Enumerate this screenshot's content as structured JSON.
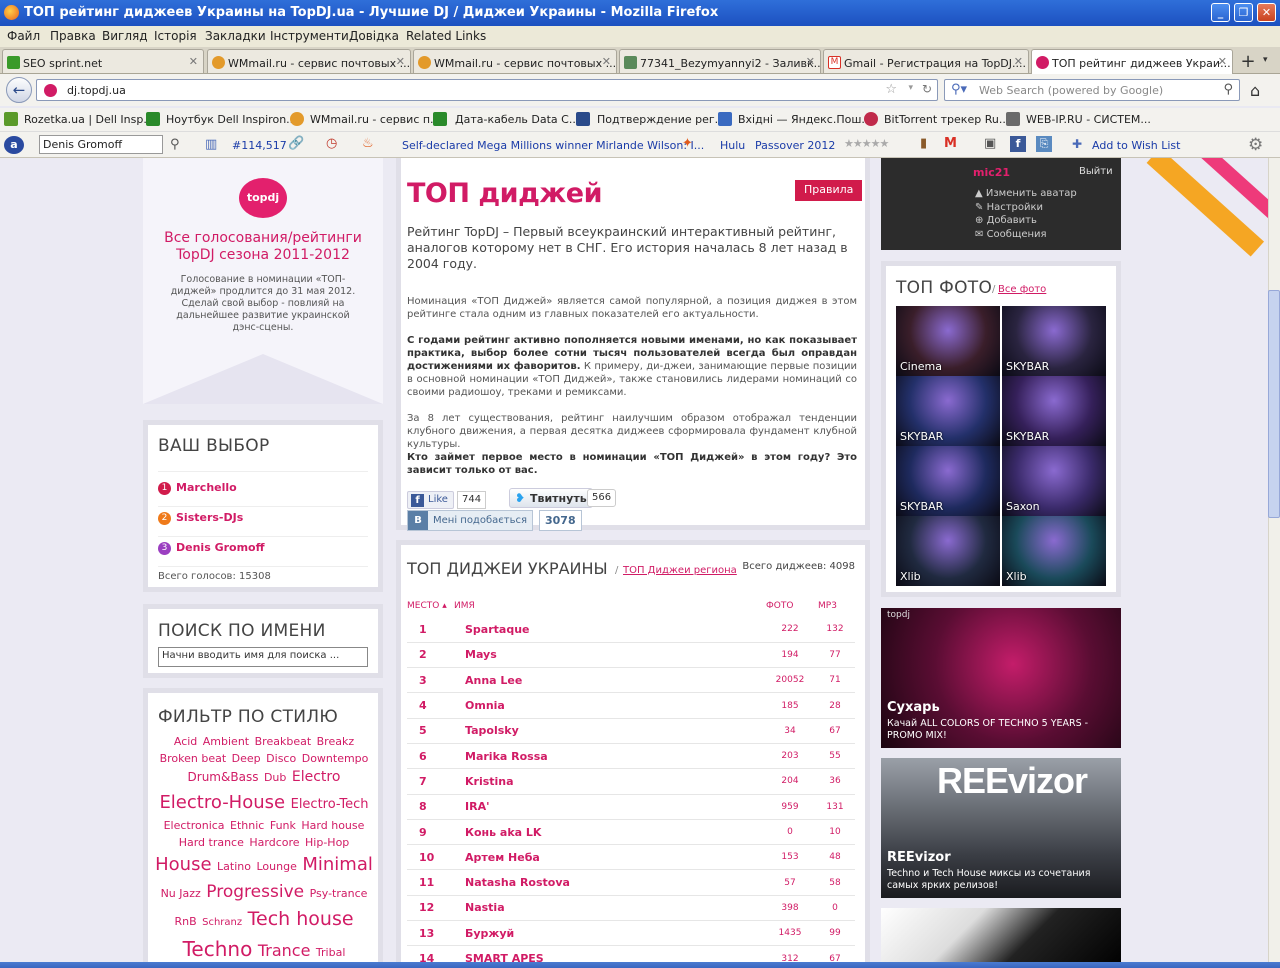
{
  "window": {
    "title": "ТОП рейтинг диджеев Украины на TopDJ.ua - Лучшие DJ / Диджеи Украины - Mozilla Firefox"
  },
  "menu": [
    "Файл",
    "Правка",
    "Вигляд",
    "Історія",
    "Закладки",
    "Інструменти",
    "Довідка",
    "Related Links"
  ],
  "tabs": [
    {
      "label": "SEO sprint.net",
      "color": "#3a9a2a"
    },
    {
      "label": "WMmail.ru - сервис почтовых ...",
      "color": "#e39a2a"
    },
    {
      "label": "WMmail.ru - сервис почтовых ...",
      "color": "#e39a2a"
    },
    {
      "label": "77341_Bezymyannyi2 - Заливк...",
      "color": "#5a8a5a"
    },
    {
      "label": "Gmail - Регистрация на TopDJ....",
      "color": "#d93025"
    },
    {
      "label": "ТОП рейтинг диджеев Украи...",
      "color": "#d11b65"
    }
  ],
  "nav": {
    "url": "dj.topdj.ua",
    "search_placeholder": "Web Search (powered by Google)"
  },
  "bookmarks": [
    "Rozetka.ua | Dell Insp...",
    "Ноутбук Dell Inspiron...",
    "WMmail.ru - сервис п...",
    "Дата-кабель Data C...",
    "Подтверждение рег...",
    "Вхідні — Яндекс.Пош...",
    "BitTorrent трекер Ru...",
    "WEB-IP.RU - СИСТЕМ..."
  ],
  "toolbar2": {
    "user": "Denis Gromoff",
    "rank": "#114,517",
    "news": "Self-declared Mega Millions winner Mirlande Wilson: I...",
    "hulu": "Hulu",
    "passover": "Passover 2012",
    "wishlist": "Add to Wish List"
  },
  "promo": {
    "logo": "topdj",
    "title": "Все голосования/рейтинги TopDJ сезона 2011-2012",
    "text": "Голосование в номинации «ТОП-диджей» продлится до 31 мая 2012. Сделай свой выбор - повлияй на дальнейшее развитие украинской дэнс-сцены."
  },
  "choice": {
    "title": "ВАШ ВЫБОР",
    "items": [
      {
        "num": "1",
        "name": "Marchello",
        "color": "#d11b4b"
      },
      {
        "num": "2",
        "name": "Sisters-DJs",
        "color": "#ef7a1a"
      },
      {
        "num": "3",
        "name": "Denis Gromoff",
        "color": "#9b3fc1"
      }
    ],
    "total": "Всего голосов: 15308"
  },
  "search_by_name": {
    "title": "ПОИСК ПО ИМЕНИ",
    "placeholder": "Начни вводить имя для поиска ..."
  },
  "style_filter": {
    "title": "ФИЛЬТР ПО СТИЛЮ",
    "tags": [
      {
        "t": "Acid",
        "s": 11
      },
      {
        "t": "Ambient",
        "s": 11
      },
      {
        "t": "Breakbeat",
        "s": 11
      },
      {
        "t": "Breakz",
        "s": 11
      },
      {
        "t": "Broken beat",
        "s": 11
      },
      {
        "t": "Deep",
        "s": 11
      },
      {
        "t": "Disco",
        "s": 11
      },
      {
        "t": "Downtempo",
        "s": 11
      },
      {
        "t": "Drum&Bass",
        "s": 12
      },
      {
        "t": "Dub",
        "s": 11
      },
      {
        "t": "Electro",
        "s": 14
      },
      {
        "t": "Electro-House",
        "s": 18
      },
      {
        "t": "Electro-Tech",
        "s": 13
      },
      {
        "t": "Electronica",
        "s": 11
      },
      {
        "t": "Ethnic",
        "s": 11
      },
      {
        "t": "Funk",
        "s": 11
      },
      {
        "t": "Hard house",
        "s": 11
      },
      {
        "t": "Hard trance",
        "s": 11
      },
      {
        "t": "Hardcore",
        "s": 11
      },
      {
        "t": "Hip-Hop",
        "s": 11
      },
      {
        "t": "House",
        "s": 18
      },
      {
        "t": "Latino",
        "s": 11
      },
      {
        "t": "Lounge",
        "s": 11
      },
      {
        "t": "Minimal",
        "s": 18
      },
      {
        "t": "Nu Jazz",
        "s": 11
      },
      {
        "t": "Progressive",
        "s": 17
      },
      {
        "t": "Psy-trance",
        "s": 11
      },
      {
        "t": "RnB",
        "s": 11
      },
      {
        "t": "Schranz",
        "s": 10
      },
      {
        "t": "Tech house",
        "s": 19
      },
      {
        "t": "Techno",
        "s": 20
      },
      {
        "t": "Trance",
        "s": 16
      },
      {
        "t": "Tribal",
        "s": 11
      }
    ]
  },
  "top_dj": {
    "title": "ТОП диджей",
    "rules": "Правила",
    "lead": "Рейтинг TopDJ – Первый всеукраинский интерактивный рейтинг, аналогов которому нет в СНГ. Его история началась 8 лет назад в 2004 году.",
    "p1": "Номинация «ТОП Диджей» является самой популярной, а позиция диджея в этом рейтинге стала одним из главных показателей его актуальности.",
    "p2_bold": "С годами рейтинг активно пополняется новыми именами, но как показывает практика, выбор более сотни тысяч пользователей всегда был оправдан достижениями их фаворитов.",
    "p2_rest": " К примеру, ди-джеи, занимающие первые позиции в основной номинации «ТОП Диджей», также становились лидерами номинаций со своими радиошоу, треками и ремиксами.",
    "p3": "За 8 лет существования, рейтинг наилучшим образом отображал тенденции клубного движения, а первая десятка диджеев сформировала фундамент клубной культуры.",
    "p4": "Кто займет первое место в номинации «ТОП Диджей» в этом году? Это зависит только от вас.",
    "fb_like": "Like",
    "fb_count": "744",
    "tw_label": "Твитнуть",
    "tw_count": "566",
    "vk_label": "Мені подобається",
    "vk_count": "3078"
  },
  "ranking": {
    "title": "ТОП ДИДЖЕИ УКРАИНЫ",
    "region_link": "ТОП Диджеи региона",
    "total": "Всего диджеев: 4098",
    "headers": {
      "place": "МЕСТО",
      "name": "ИМЯ",
      "photo": "ФОТО",
      "mp3": "MP3"
    },
    "rows": [
      [
        "1",
        "Spartaque",
        "222",
        "132"
      ],
      [
        "2",
        "Mays",
        "194",
        "77"
      ],
      [
        "3",
        "Anna Lee",
        "20052",
        "71"
      ],
      [
        "4",
        "Omnia",
        "185",
        "28"
      ],
      [
        "5",
        "Tapolsky",
        "34",
        "67"
      ],
      [
        "6",
        "Marika Rossa",
        "203",
        "55"
      ],
      [
        "7",
        "Kristina",
        "204",
        "36"
      ],
      [
        "8",
        "IRA'",
        "959",
        "131"
      ],
      [
        "9",
        "Конь aka LK",
        "0",
        "10"
      ],
      [
        "10",
        "Артем Неба",
        "153",
        "48"
      ],
      [
        "11",
        "Natasha Rostova",
        "57",
        "58"
      ],
      [
        "12",
        "Nastia",
        "398",
        "0"
      ],
      [
        "13",
        "Буржуй",
        "1435",
        "99"
      ],
      [
        "14",
        "SMART APES",
        "312",
        "67"
      ]
    ]
  },
  "user_box": {
    "username": "mic21",
    "logout": "Выйти",
    "links": [
      "Изменить аватар",
      "Настройки",
      "Добавить",
      "Сообщения"
    ]
  },
  "top_photo": {
    "title": "ТОП ФОТО",
    "all_link": "Все фото",
    "photos": [
      {
        "cap": "Cinema",
        "bg": "#3a1e2a"
      },
      {
        "cap": "SKYBAR",
        "bg": "#2a2440"
      },
      {
        "cap": "SKYBAR",
        "bg": "#23306a"
      },
      {
        "cap": "SKYBAR",
        "bg": "#35205a"
      },
      {
        "cap": "SKYBAR",
        "bg": "#1e2a5e"
      },
      {
        "cap": "Saxon",
        "bg": "#3a2a6a"
      },
      {
        "cap": "Xlib",
        "bg": "#202a40"
      },
      {
        "cap": "Xlib",
        "bg": "#1a4a5a"
      }
    ]
  },
  "banners": [
    {
      "title": "Сухарь",
      "text": "Качай ALL COLORS OF TECHNO 5 YEARS - PROMO MIX!"
    },
    {
      "brand": "REEvizor",
      "title": "REEvizor",
      "text": "Techno и Tech House миксы из сочетания самых ярких релизов!"
    }
  ]
}
